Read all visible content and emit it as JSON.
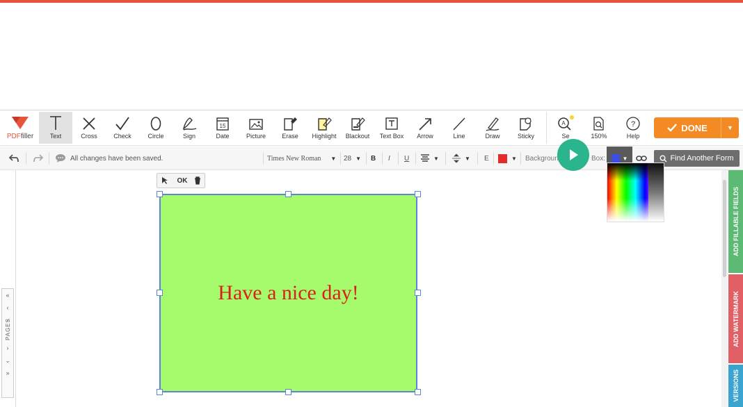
{
  "logo": {
    "brand_prefix": "PDF",
    "brand_suffix": "filler"
  },
  "tools": [
    {
      "label": "Text",
      "icon": "text-icon"
    },
    {
      "label": "Cross",
      "icon": "cross-icon"
    },
    {
      "label": "Check",
      "icon": "check-icon"
    },
    {
      "label": "Circle",
      "icon": "circle-icon"
    },
    {
      "label": "Sign",
      "icon": "sign-icon"
    },
    {
      "label": "Date",
      "icon": "date-icon"
    },
    {
      "label": "Picture",
      "icon": "picture-icon"
    },
    {
      "label": "Erase",
      "icon": "erase-icon"
    },
    {
      "label": "Highlight",
      "icon": "highlight-icon"
    },
    {
      "label": "Blackout",
      "icon": "blackout-icon"
    },
    {
      "label": "Text Box",
      "icon": "textbox-icon"
    },
    {
      "label": "Arrow",
      "icon": "arrow-icon"
    },
    {
      "label": "Line",
      "icon": "line-icon"
    },
    {
      "label": "Draw",
      "icon": "draw-icon"
    },
    {
      "label": "Sticky",
      "icon": "sticky-icon"
    }
  ],
  "right_tools": [
    {
      "label": "Se",
      "icon": "search-icon"
    },
    {
      "label": "150%",
      "icon": "zoom-icon"
    },
    {
      "label": "Help",
      "icon": "help-icon"
    }
  ],
  "date_icon_day": "15",
  "done_label": "DONE",
  "status_text": "All changes have been saved.",
  "font_name": "Times New Roman",
  "font_size": "28",
  "bold": "B",
  "italic": "I",
  "underline": "U",
  "spacing_letter": "E",
  "background_label": "Backgroun",
  "box_label": "Box:",
  "find_label": "Find Another Form",
  "mini_ok": "OK",
  "box_text": "Have a nice day!",
  "pages_label": "PAGES",
  "side_tabs": {
    "fillable": "ADD FILLABLE FIELDS",
    "watermark": "ADD WATERMARK",
    "versions": "VERSIONS"
  },
  "colors": {
    "accent_orange": "#f38a24",
    "brand_red": "#e8533b",
    "box_fill": "#a6fb6c",
    "text_red": "#d8201c",
    "play_green": "#2bb58f",
    "tab_green": "#5cba74",
    "tab_red": "#e06066",
    "tab_blue": "#3ba3cf"
  }
}
